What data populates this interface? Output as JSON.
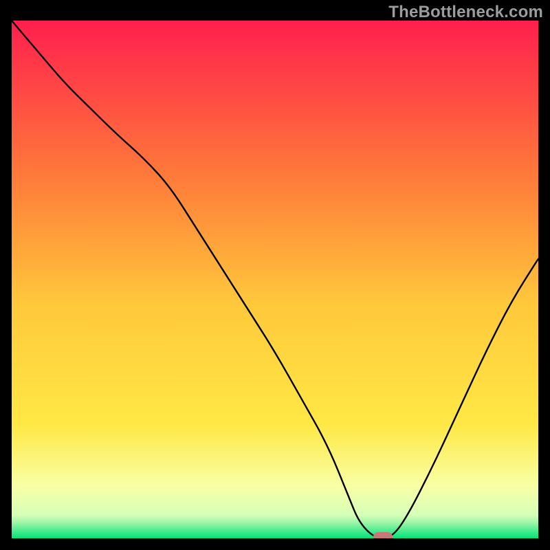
{
  "watermark": "TheBottleneck.com",
  "chart_data": {
    "type": "line",
    "title": "",
    "xlabel": "",
    "ylabel": "",
    "xlim": [
      0,
      100
    ],
    "ylim": [
      0,
      100
    ],
    "series": [
      {
        "name": "bottleneck-curve",
        "x": [
          0,
          5,
          10,
          15,
          20,
          25,
          30,
          35,
          40,
          45,
          50,
          55,
          60,
          64,
          66,
          69,
          72,
          75,
          80,
          85,
          90,
          95,
          100
        ],
        "y": [
          100,
          94,
          88,
          83,
          78,
          73.5,
          68,
          60,
          52,
          44,
          36,
          27,
          18,
          8,
          3,
          0,
          0,
          4,
          14,
          25,
          36,
          46,
          54
        ]
      }
    ],
    "marker": {
      "x": 70.5,
      "y": 0
    },
    "gradient_stops": [
      {
        "offset": 0.0,
        "color": "#ff1f4d"
      },
      {
        "offset": 0.3,
        "color": "#ff7a3a"
      },
      {
        "offset": 0.55,
        "color": "#ffc93b"
      },
      {
        "offset": 0.78,
        "color": "#ffe845"
      },
      {
        "offset": 0.9,
        "color": "#f8ffa6"
      },
      {
        "offset": 0.955,
        "color": "#d6ffb8"
      },
      {
        "offset": 0.97,
        "color": "#9bf5a6"
      },
      {
        "offset": 1.0,
        "color": "#00e37a"
      }
    ]
  }
}
